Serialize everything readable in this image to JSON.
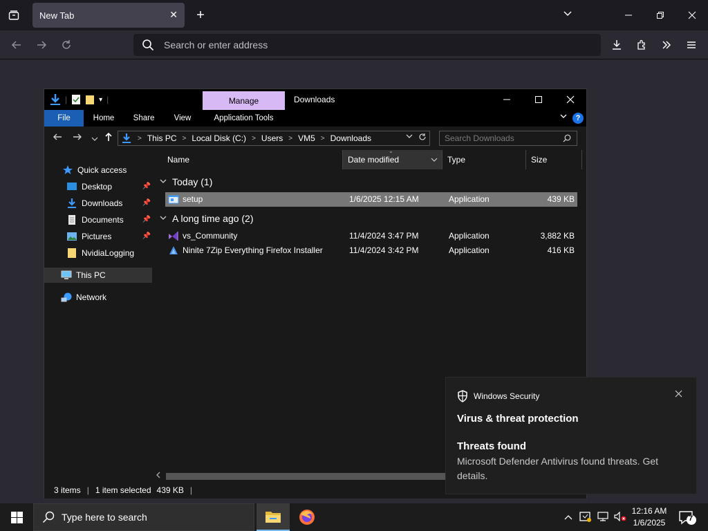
{
  "browser": {
    "tab_title": "New Tab",
    "url_placeholder": "Search or enter address"
  },
  "explorer": {
    "ribbon_context_tab": "Manage",
    "window_title": "Downloads",
    "ribbon_tabs": [
      "File",
      "Home",
      "Share",
      "View",
      "Application Tools"
    ],
    "breadcrumb": [
      "This PC",
      "Local Disk (C:)",
      "Users",
      "VM5",
      "Downloads"
    ],
    "search_placeholder": "Search Downloads",
    "nav": {
      "quick_access": "Quick access",
      "desktop": "Desktop",
      "downloads": "Downloads",
      "documents": "Documents",
      "pictures": "Pictures",
      "nvidia": "NvidiaLogging",
      "this_pc": "This PC",
      "network": "Network"
    },
    "columns": {
      "name": "Name",
      "date": "Date modified",
      "type": "Type",
      "size": "Size"
    },
    "groups": [
      {
        "label": "Today (1)",
        "rows": [
          {
            "name": "setup",
            "date": "1/6/2025 12:15 AM",
            "type": "Application",
            "size": "439 KB"
          }
        ]
      },
      {
        "label": "A long time ago (2)",
        "rows": [
          {
            "name": "vs_Community",
            "date": "11/4/2024 3:47 PM",
            "type": "Application",
            "size": "3,882 KB"
          },
          {
            "name": "Ninite 7Zip Everything Firefox Installer",
            "date": "11/4/2024 3:42 PM",
            "type": "Application",
            "size": "416 KB"
          }
        ]
      }
    ],
    "status": {
      "items": "3 items",
      "selected": "1 item selected",
      "size": "439 KB"
    }
  },
  "toast": {
    "app": "Windows Security",
    "title": "Virus & threat protection",
    "heading": "Threats found",
    "body": "Microsoft Defender Antivirus found threats. Get details."
  },
  "taskbar": {
    "search_placeholder": "Type here to search",
    "time": "12:16 AM",
    "date": "1/6/2025",
    "notification_count": "7"
  },
  "colors": {
    "manage_tab": "#d7b9f5",
    "file_tab": "#1a5fb4",
    "accent": "#76b9ed"
  }
}
